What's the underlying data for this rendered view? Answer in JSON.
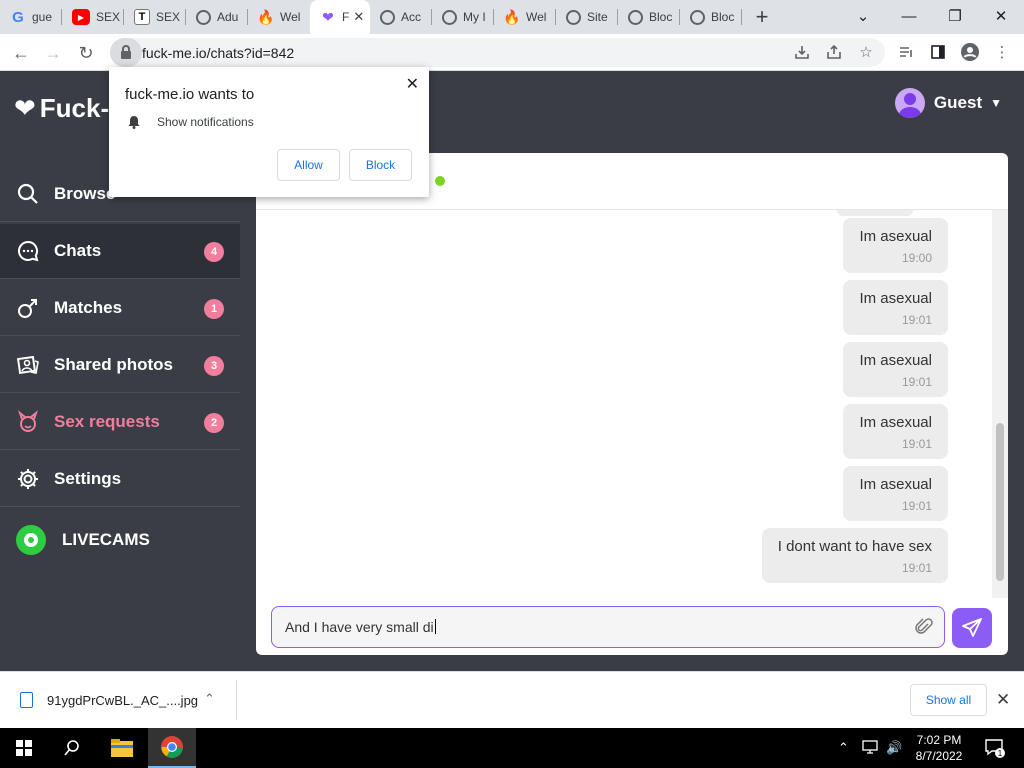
{
  "browser": {
    "tabs": [
      {
        "label": "gue",
        "favicon": "google-g-icon"
      },
      {
        "label": "SEX",
        "favicon": "youtube-icon"
      },
      {
        "label": "SEX",
        "favicon": "t-icon"
      },
      {
        "label": "Adu",
        "favicon": "globe-icon"
      },
      {
        "label": "Wel",
        "favicon": "fire-icon"
      },
      {
        "label": "F",
        "favicon": "heart-icon",
        "active": true
      },
      {
        "label": "Acc",
        "favicon": "globe-icon"
      },
      {
        "label": "My I",
        "favicon": "globe-icon"
      },
      {
        "label": "Wel",
        "favicon": "fire-icon"
      },
      {
        "label": "Site",
        "favicon": "globe-icon"
      },
      {
        "label": "Bloc",
        "favicon": "globe-icon"
      },
      {
        "label": "Bloc",
        "favicon": "globe-icon"
      }
    ],
    "url": "fuck-me.io/chats?id=842"
  },
  "site": {
    "logo_text": "Fuck-",
    "user_name": "Guest"
  },
  "sidebar": {
    "items": [
      {
        "label": "Browse"
      },
      {
        "label": "Chats",
        "badge": "4"
      },
      {
        "label": "Matches",
        "badge": "1"
      },
      {
        "label": "Shared photos",
        "badge": "3"
      },
      {
        "label": "Sex requests",
        "badge": "2"
      },
      {
        "label": "Settings"
      }
    ],
    "livecams_label": "LIVECAMS"
  },
  "chat": {
    "messages": [
      {
        "text": "Im asexual",
        "time": "19:00"
      },
      {
        "text": "Im asexual",
        "time": "19:01"
      },
      {
        "text": "Im asexual",
        "time": "19:01"
      },
      {
        "text": "Im asexual",
        "time": "19:01"
      },
      {
        "text": "Im asexual",
        "time": "19:01"
      },
      {
        "text": "I dont want to have sex",
        "time": "19:01"
      }
    ],
    "composer_value": "And I have very small di"
  },
  "permission_popup": {
    "title": "fuck-me.io wants to",
    "permission": "Show notifications",
    "allow_label": "Allow",
    "block_label": "Block"
  },
  "downloads": {
    "filename": "91ygdPrCwBL._AC_....jpg",
    "show_all_label": "Show all"
  },
  "taskbar": {
    "time": "7:02 PM",
    "date": "8/7/2022",
    "notification_count": "1"
  },
  "colors": {
    "accent": "#8b5cf6",
    "badge": "#f07e9c",
    "sidebar_bg": "#3a3d46",
    "online": "#7ed321"
  }
}
